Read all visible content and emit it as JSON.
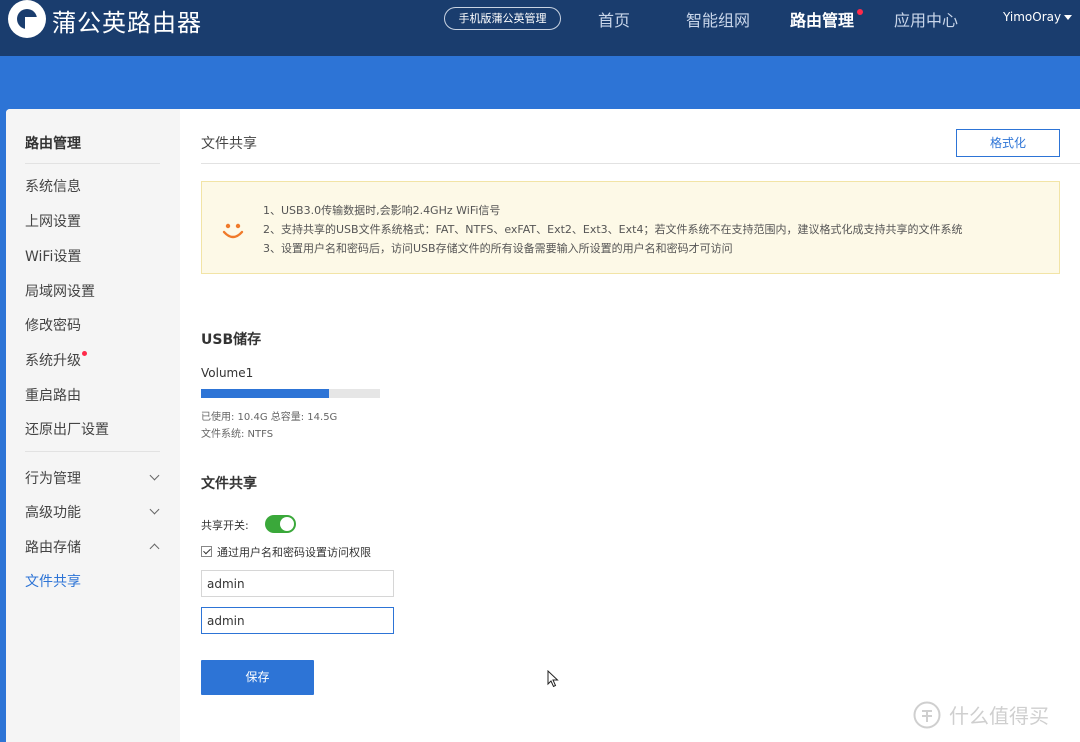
{
  "app": {
    "brand": "蒲公英路由器",
    "mobile_manage": "手机版蒲公英管理"
  },
  "nav": {
    "items": [
      "首页",
      "智能组网",
      "路由管理",
      "应用中心"
    ],
    "active_index": 2,
    "user": "YimoOray"
  },
  "sidebar": {
    "title": "路由管理",
    "items": [
      "系统信息",
      "上网设置",
      "WiFi设置",
      "局域网设置",
      "修改密码",
      "系统升级",
      "重启路由",
      "还原出厂设置"
    ],
    "groups": [
      "行为管理",
      "高级功能",
      "路由存储"
    ],
    "sub_item": "文件共享"
  },
  "content": {
    "title": "文件共享",
    "format_button": "格式化",
    "notice": [
      "1、USB3.0传输数据时,会影响2.4GHz WiFi信号",
      "2、支持共享的USB文件系统格式：FAT、NTFS、exFAT、Ext2、Ext3、Ext4；若文件系统不在支持范围内，建议格式化成支持共享的文件系统",
      "3、设置用户名和密码后，访问USB存储文件的所有设备需要输入所设置的用户名和密码才可访问"
    ],
    "usb_title": "USB储存",
    "volume": "Volume1",
    "used_line": "已使用:  10.4G   总容量:  14.5G",
    "fs_line": "文件系统:  NTFS",
    "usage_fraction": 0.717,
    "share_title": "文件共享",
    "share_switch_label": "共享开关:",
    "share_enabled": true,
    "auth_checkbox_label": "通过用户名和密码设置访问权限",
    "auth_checked": true,
    "username": "admin",
    "password": "admin",
    "save_button": "保存"
  },
  "watermark": "什么值得买",
  "colors": {
    "header_bg": "#1a3d6e",
    "accent": "#2d74d6",
    "toggle_on": "#3aa83a",
    "alert_dot": "#ff2a4a",
    "notice_bg": "#fdf9e7"
  }
}
